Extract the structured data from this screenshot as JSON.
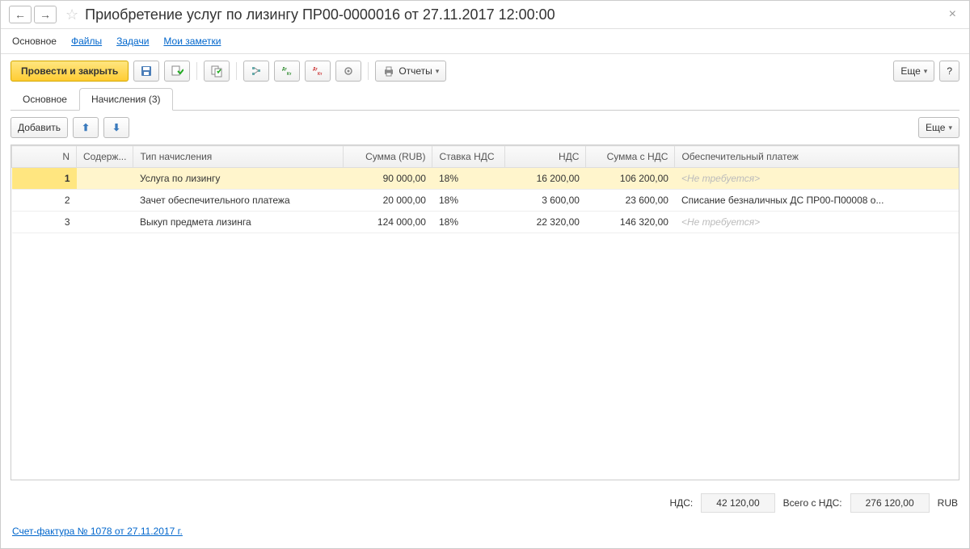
{
  "title": "Приобретение услуг по лизингу ПР00-0000016 от 27.11.2017 12:00:00",
  "linkTabs": {
    "main": "Основное",
    "files": "Файлы",
    "tasks": "Задачи",
    "notes": "Мои заметки"
  },
  "toolbar": {
    "postAndClose": "Провести и закрыть",
    "reports": "Отчеты",
    "more": "Еще",
    "help": "?"
  },
  "sectionTabs": {
    "main": "Основное",
    "accruals": "Начисления (3)"
  },
  "subToolbar": {
    "add": "Добавить",
    "more": "Еще"
  },
  "table": {
    "headers": {
      "n": "N",
      "content": "Содерж...",
      "type": "Тип начисления",
      "amount": "Сумма (RUB)",
      "vatRate": "Ставка НДС",
      "vat": "НДС",
      "amountWithVat": "Сумма с НДС",
      "securityPayment": "Обеспечительный платеж"
    },
    "rows": [
      {
        "n": "1",
        "content": "",
        "type": "Услуга по лизингу",
        "amount": "90 000,00",
        "vatRate": "18%",
        "vat": "16 200,00",
        "amountWithVat": "106 200,00",
        "security": "<Не требуется>",
        "securityPlaceholder": true,
        "selected": true
      },
      {
        "n": "2",
        "content": "",
        "type": "Зачет обеспечительного платежа",
        "amount": "20 000,00",
        "vatRate": "18%",
        "vat": "3 600,00",
        "amountWithVat": "23 600,00",
        "security": "Списание безналичных ДС ПР00-П00008 о...",
        "securityPlaceholder": false,
        "selected": false
      },
      {
        "n": "3",
        "content": "",
        "type": "Выкуп предмета лизинга",
        "amount": "124 000,00",
        "vatRate": "18%",
        "vat": "22 320,00",
        "amountWithVat": "146 320,00",
        "security": "<Не требуется>",
        "securityPlaceholder": true,
        "selected": false
      }
    ]
  },
  "totals": {
    "vatLabel": "НДС:",
    "vatValue": "42 120,00",
    "totalLabel": "Всего с НДС:",
    "totalValue": "276 120,00",
    "currency": "RUB"
  },
  "invoiceLink": "Счет-фактура № 1078 от 27.11.2017 г."
}
